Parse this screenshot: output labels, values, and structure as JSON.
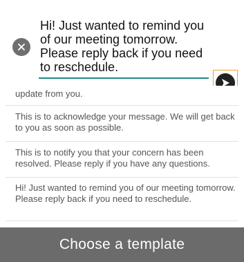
{
  "compose": {
    "message": "Hi! Just wanted to remind you of our meeting tomorrow. Please reply back if you need to reschedule."
  },
  "templates": [
    "update from you.",
    "This is to acknowledge your message. We will get back to you as soon as possible.",
    "This is to notify you that your concern has been resolved. Please reply if you have any questions.",
    "Hi! Just wanted to remind you of our meeting tomorrow. Please reply back if you need to reschedule."
  ],
  "footer": {
    "label": "Choose a template"
  },
  "colors": {
    "accent_underline": "#1e8a80",
    "send_highlight": "#f0a030",
    "footer_bg": "#6b6b6b"
  }
}
